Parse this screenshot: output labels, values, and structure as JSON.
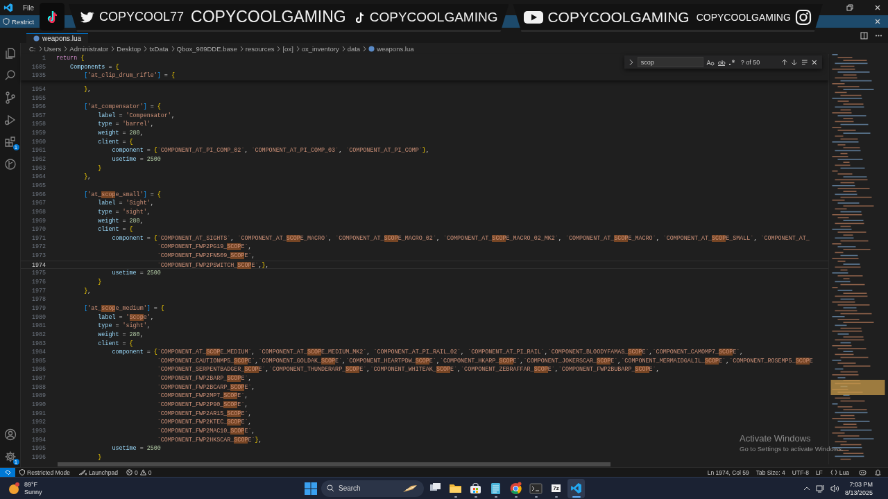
{
  "title_bar": {
    "menu": [
      "File"
    ]
  },
  "overlay": {
    "items": [
      {
        "kind": "twitter",
        "label": "COPYCOOL77"
      },
      {
        "kind": "plain",
        "label": "COPYCOOLGAMING"
      },
      {
        "kind": "tiktok",
        "label": "COPYCOOLGAMING"
      },
      {
        "kind": "youtube",
        "label": "COPYCOOLGAMING"
      },
      {
        "kind": "instagram",
        "label": "COPYCOOLGAMING"
      }
    ]
  },
  "restricted_banner": {
    "text": "Restrict"
  },
  "tab": {
    "label": "weapons.lua"
  },
  "activity_bar": {
    "extensions_badge": "1",
    "settings_badge": "1"
  },
  "breadcrumbs": [
    "C:",
    "Users",
    "Administrator",
    "Desktop",
    "txData",
    "Qbox_989DDE.base",
    "resources",
    "[ox]",
    "ox_inventory",
    "data",
    "weapons.lua"
  ],
  "find": {
    "query": "scop",
    "count": "? of 50"
  },
  "sticky_lines": [
    {
      "n": "1",
      "text": "return {"
    },
    {
      "n": "1605",
      "text": "    Components = {"
    },
    {
      "n": "1935",
      "text": "        ['at_clip_drum_rifle'] = {"
    }
  ],
  "lines": [
    {
      "n": "1954",
      "text": "        },",
      "current": false
    },
    {
      "n": "1955",
      "current": false
    },
    {
      "n": "1956",
      "text": "        ['at_compensator'] = {",
      "current": false
    },
    {
      "n": "1957",
      "text": "            label = 'Compensator',",
      "current": false
    },
    {
      "n": "1958",
      "text": "            type = 'barrel',",
      "current": false
    },
    {
      "n": "1959",
      "text": "            weight = 280,",
      "current": false
    },
    {
      "n": "1960",
      "text": "            client = {",
      "current": false
    },
    {
      "n": "1961",
      "text": "                component = {`COMPONENT_AT_PI_COMP_02`, `COMPONENT_AT_PI_COMP_03`, `COMPONENT_AT_PI_COMP`},",
      "current": false
    },
    {
      "n": "1962",
      "text": "                usetime = 2500",
      "current": false
    },
    {
      "n": "1963",
      "text": "            }",
      "current": false
    },
    {
      "n": "1964",
      "text": "        },",
      "current": false
    },
    {
      "n": "1965",
      "current": false
    },
    {
      "n": "1966",
      "text": "        ['at_scope_small'] = {",
      "current": false
    },
    {
      "n": "1967",
      "text": "            label = 'Sight',",
      "current": false
    },
    {
      "n": "1968",
      "text": "            type = 'sight',",
      "current": false
    },
    {
      "n": "1969",
      "text": "            weight = 280,",
      "current": false
    },
    {
      "n": "1970",
      "text": "            client = {",
      "current": false
    },
    {
      "n": "1971",
      "text": "                component = {`COMPONENT_AT_SIGHTS`, `COMPONENT_AT_SCOPE_MACRO`, `COMPONENT_AT_SCOPE_MACRO_02`, `COMPONENT_AT_SCOPE_MACRO_02_MK2`, `COMPONENT_AT_SCOPE_MACRO`, `COMPONENT_AT_SCOPE_SMALL`, `COMPONENT_AT_",
      "current": false
    },
    {
      "n": "1972",
      "text": "                             `COMPONENT_FWP2PG19_SCOPE`,",
      "current": false
    },
    {
      "n": "1973",
      "text": "                             `COMPONENT_FWP2FN509_SCOPE`,",
      "current": false
    },
    {
      "n": "1974",
      "text": "                             `COMPONENT_FWP2PSWITCH_SCOPE`,},",
      "current": true
    },
    {
      "n": "1975",
      "text": "                usetime = 2500",
      "current": false
    },
    {
      "n": "1976",
      "text": "            }",
      "current": false
    },
    {
      "n": "1977",
      "text": "        },",
      "current": false
    },
    {
      "n": "1978",
      "current": false
    },
    {
      "n": "1979",
      "text": "        ['at_scope_medium'] = {",
      "current": false
    },
    {
      "n": "1980",
      "text": "            label = 'Scope',",
      "current": false
    },
    {
      "n": "1981",
      "text": "            type = 'sight',",
      "current": false
    },
    {
      "n": "1982",
      "text": "            weight = 280,",
      "current": false
    },
    {
      "n": "1983",
      "text": "            client = {",
      "current": false
    },
    {
      "n": "1984",
      "text": "                component = {`COMPONENT_AT_SCOPE_MEDIUM`, `COMPONENT_AT_SCOPE_MEDIUM_MK2`, `COMPONENT_AT_PI_RAIL_02`, `COMPONENT_AT_PI_RAIL`,`COMPONENT_BLOODYFAMAS_SCOPE`,`COMPONENT_CAMOMP7_SCOPE`,",
      "current": false
    },
    {
      "n": "1985",
      "text": "                             `COMPONENT_CAUTIONMP5_SCOPE`,`COMPONENT_GOLDAK_SCOPE`,`COMPONENT_HEARTPDW_SCOPE`,`COMPONENT_HKARP_SCOPE`,`COMPONENT_JOKERSCAR_SCOPE`,`COMPONENT_MERMAIDGALIL_SCOPE`,`COMPONENT_ROSEMP5_SCOPE",
      "current": false
    },
    {
      "n": "1986",
      "text": "                             `COMPONENT_SERPENTBADGER_SCOPE`,`COMPONENT_THUNDERARP_SCOPE`,`COMPONENT_WHITEAK_SCOPE`,`COMPONENT_ZEBRAFFAR_SCOPE`,`COMPONENT_FWP2BUBARP_SCOPE`,",
      "current": false
    },
    {
      "n": "1987",
      "text": "                             `COMPONENT_FWP2BARP_SCOPE`,",
      "current": false
    },
    {
      "n": "1988",
      "text": "                             `COMPONENT_FWP2BCARP_SCOPE`,",
      "current": false
    },
    {
      "n": "1989",
      "text": "                             `COMPONENT_FWP2MP7_SCOPE`,",
      "current": false
    },
    {
      "n": "1990",
      "text": "                             `COMPONENT_FWP2P90_SCOPE`,",
      "current": false
    },
    {
      "n": "1991",
      "text": "                             `COMPONENT_FWP2AR15_SCOPE`,",
      "current": false
    },
    {
      "n": "1992",
      "text": "                             `COMPONENT_FWP2KTEC_SCOPE`,",
      "current": false
    },
    {
      "n": "1993",
      "text": "                             `COMPONENT_FWP2MAC10_SCOPE`,",
      "current": false
    },
    {
      "n": "1994",
      "text": "                             `COMPONENT_FWP2HKSCAR_SCOPE`},",
      "current": false
    },
    {
      "n": "1995",
      "text": "                usetime = 2500",
      "current": false
    },
    {
      "n": "1996",
      "text": "            }",
      "current": false
    }
  ],
  "activation_notice": {
    "title": "Activate Windows",
    "subtitle": "Go to Settings to activate Windows."
  },
  "status_bar": {
    "restricted": "Restricted Mode",
    "launchpad": "Launchpad",
    "errors": "0",
    "warnings": "0",
    "position": "Ln 1974, Col 59",
    "tab_size": "Tab Size: 4",
    "encoding": "UTF-8",
    "eol": "LF",
    "language": "Lua"
  },
  "taskbar": {
    "weather": {
      "temp": "89°F",
      "condition": "Sunny"
    },
    "search": {
      "placeholder": "Search"
    },
    "apps": [
      {
        "kind": "taskview",
        "active": false
      },
      {
        "kind": "explorer",
        "active": false
      },
      {
        "kind": "store",
        "active": false
      },
      {
        "kind": "notepad",
        "active": false
      },
      {
        "kind": "chrome",
        "active": false
      },
      {
        "kind": "terminal",
        "active": false
      },
      {
        "kind": "archiver",
        "label": "7z",
        "active": false
      },
      {
        "kind": "vscode",
        "active": true
      }
    ],
    "time": "7:03 PM",
    "date": "8/13/2025"
  }
}
